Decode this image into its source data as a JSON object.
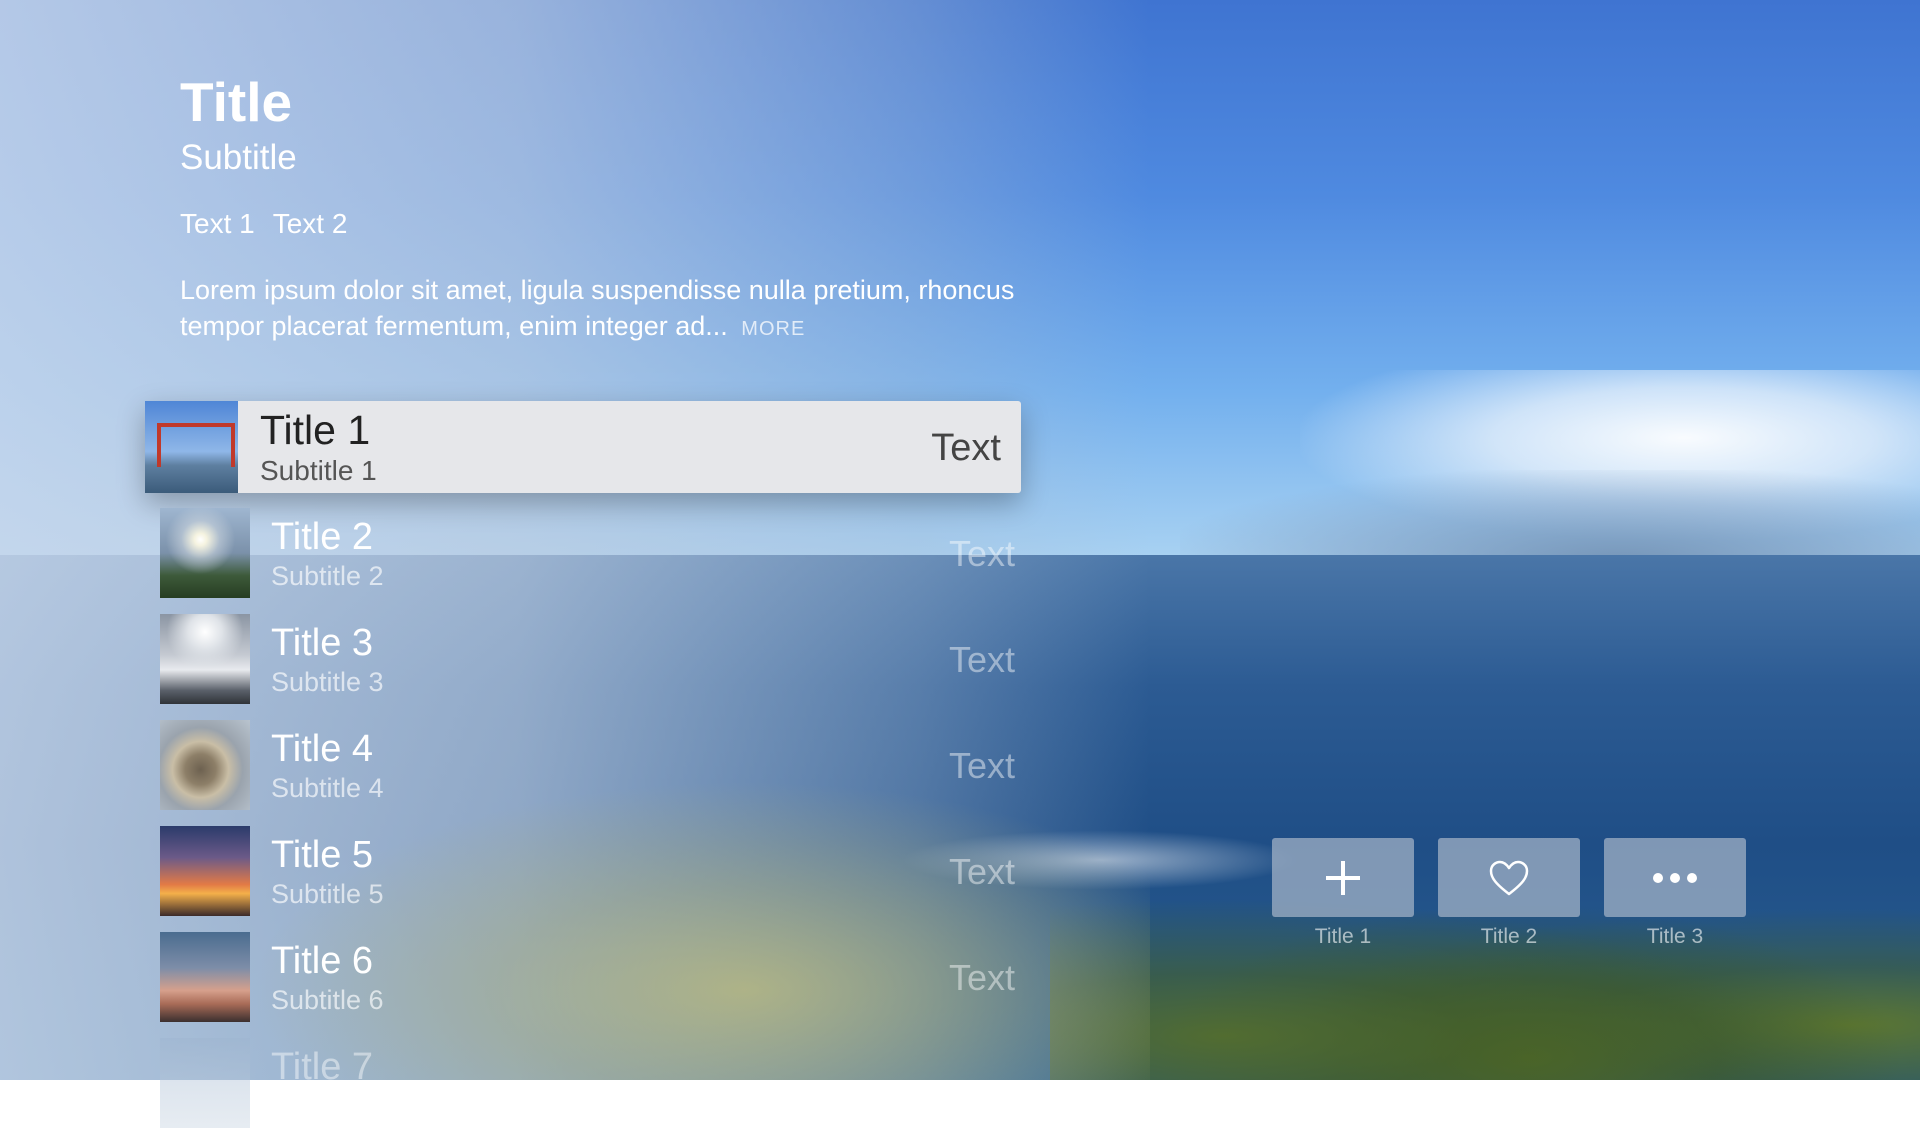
{
  "header": {
    "title": "Title",
    "subtitle": "Subtitle",
    "meta": [
      "Text 1",
      "Text 2"
    ],
    "description": "Lorem ipsum dolor sit amet, ligula suspendisse nulla pretium, rhoncus tempor placerat fermentum, enim integer ad...",
    "more_label": "MORE"
  },
  "list": {
    "items": [
      {
        "title": "Title 1",
        "subtitle": "Subtitle 1",
        "accessory": "Text",
        "focused": true,
        "thumb": "golden-gate-bridge-photo"
      },
      {
        "title": "Title 2",
        "subtitle": "Subtitle 2",
        "accessory": "Text",
        "focused": false,
        "thumb": "sunset-sky-photo"
      },
      {
        "title": "Title 3",
        "subtitle": "Subtitle 3",
        "accessory": "Text",
        "focused": false,
        "thumb": "snowy-mountain-photo"
      },
      {
        "title": "Title 4",
        "subtitle": "Subtitle 4",
        "accessory": "Text",
        "focused": false,
        "thumb": "water-wheel-photo"
      },
      {
        "title": "Title 5",
        "subtitle": "Subtitle 5",
        "accessory": "Text",
        "focused": false,
        "thumb": "palm-sunset-photo"
      },
      {
        "title": "Title 6",
        "subtitle": "Subtitle 6",
        "accessory": "Text",
        "focused": false,
        "thumb": "palm-beach-photo"
      },
      {
        "title": "Title 7",
        "subtitle": "",
        "accessory": "",
        "focused": false,
        "thumb": "sky-photo"
      }
    ]
  },
  "actions": [
    {
      "label": "Title 1",
      "icon": "plus-icon"
    },
    {
      "label": "Title 2",
      "icon": "heart-icon"
    },
    {
      "label": "Title 3",
      "icon": "more-icon"
    }
  ],
  "background": {
    "scene": "ocean-coast-with-palms",
    "sky_color": "#4f8ae0",
    "sea_color": "#2c5b93"
  }
}
